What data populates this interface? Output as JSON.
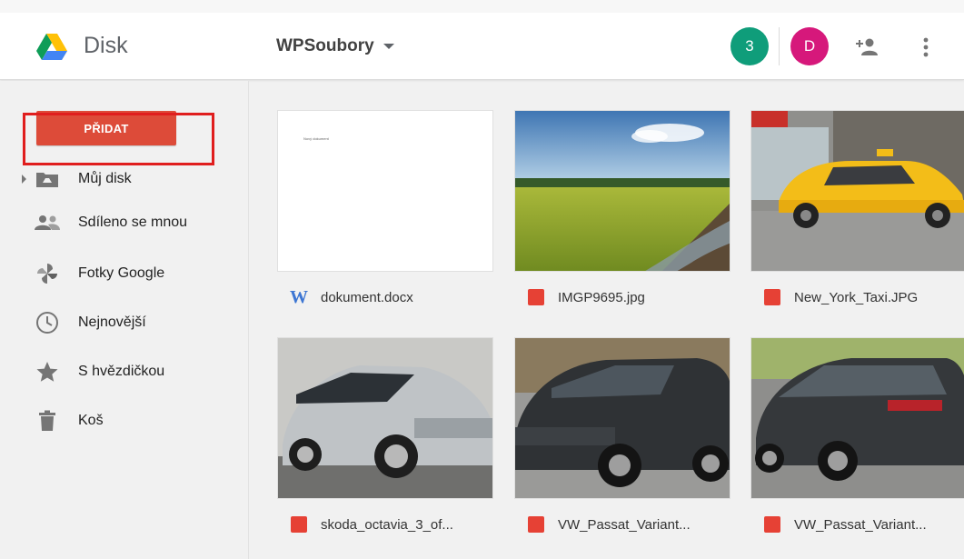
{
  "app": {
    "title": "Disk"
  },
  "header": {
    "folder_name": "WPSoubory",
    "badge_count": "3",
    "user_initial": "D",
    "icons": [
      "add-person-icon",
      "more-vert-icon"
    ]
  },
  "sidebar": {
    "new_button_label": "PŘIDAT",
    "items": [
      {
        "label": "Můj disk",
        "icon": "my-drive-icon"
      },
      {
        "label": "Sdíleno se mnou",
        "icon": "shared-people-icon",
        "highlighted": true
      },
      {
        "label": "Fotky Google",
        "icon": "google-photos-icon"
      },
      {
        "label": "Nejnovější",
        "icon": "clock-icon"
      },
      {
        "label": "S hvězdičkou",
        "icon": "star-icon"
      },
      {
        "label": "Koš",
        "icon": "trash-icon"
      }
    ]
  },
  "files": [
    {
      "name": "dokument.docx",
      "type": "word",
      "preview_text": "Nový dokument"
    },
    {
      "name": "IMGP9695.jpg",
      "type": "image"
    },
    {
      "name": "New_York_Taxi.JPG",
      "type": "image"
    },
    {
      "name": "skoda_octavia_3_of...",
      "type": "image"
    },
    {
      "name": "VW_Passat_Variant...",
      "type": "image"
    },
    {
      "name": "VW_Passat_Variant...",
      "type": "image"
    }
  ],
  "colors": {
    "accent_red": "#dd4b39",
    "badge_teal": "#0f9d7a",
    "badge_pink": "#d6187b",
    "image_icon_red": "#e64135",
    "word_blue": "#3d76d3"
  }
}
